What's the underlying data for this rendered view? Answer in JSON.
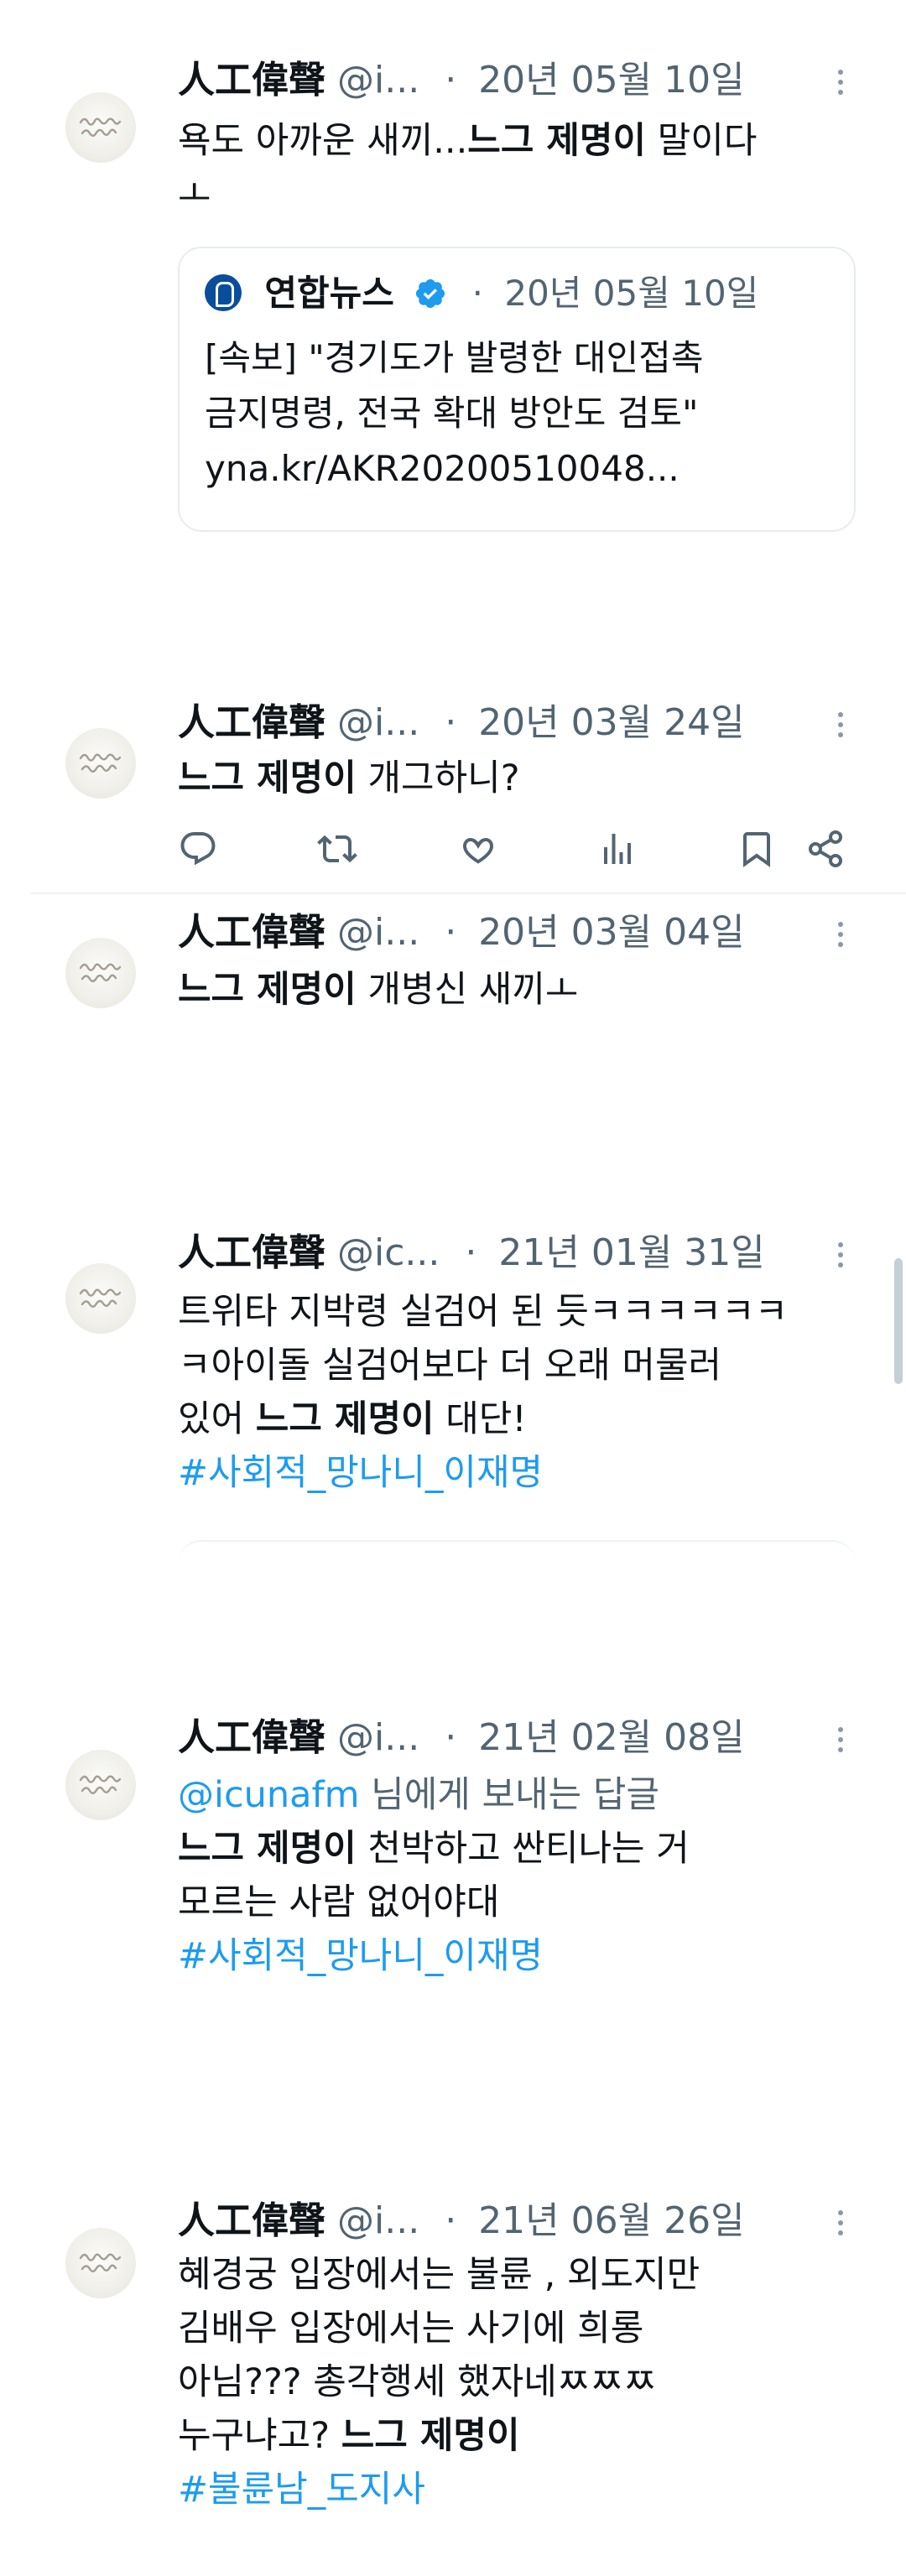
{
  "author": {
    "name": "人工偉聲"
  },
  "tweets": [
    {
      "handle": "@i...",
      "date": "20년 05월 10일",
      "text_before": "욕도 아까운 새끼...",
      "mention": "느그 제명이",
      "text_after": " 말이다\nㅗ",
      "quote": {
        "source": "연합뉴스",
        "date": "20년 05월 10일",
        "text": "[속보] \"경기도가 발령한 대인접촉\n금지명령, 전국 확대 방안도 검토\"\nyna.kr/AKR20200510048..."
      }
    },
    {
      "handle": "@i...",
      "date": "20년 03월 24일",
      "mention": "느그 제명이",
      "text_after": " 개그하니?"
    },
    {
      "handle": "@i...",
      "date": "20년 03월 04일",
      "mention": "느그 제명이",
      "text_after": " 개병신 새끼ㅗ"
    },
    {
      "handle": "@ic...",
      "date": "21년 01월 31일",
      "text_before": "트위타 지박령 실검어 된 듯ㅋㅋㅋㅋㅋㅋ\nㅋ아이돌 실검어보다 더 오래 머물러\n있어 ",
      "mention": "느그 제명이",
      "text_after": " 대단!",
      "hashtag": "#사회적_망나니_이재명"
    },
    {
      "handle": "@i...",
      "date": "21년 02월 08일",
      "reply_to": "@icunafm",
      "reply_suffix": " 님에게 보내는 답글",
      "mention": "느그 제명이",
      "text_after": " 천박하고 싼티나는 거\n모르는 사람 없어야대",
      "hashtag": "#사회적_망나니_이재명"
    },
    {
      "handle": "@i...",
      "date": "21년 06월 26일",
      "text_before": "혜경궁 입장에서는 불륜 , 외도지만\n김배우 입장에서는 사기에 희롱\n아님??? 총각행세 했자네ㅉㅉㅉ\n누구냐고? ",
      "mention": "느그 제명이",
      "hashtag": "#불륜남_도지사"
    }
  ],
  "icons": {
    "reply": "reply-icon",
    "retweet": "retweet-icon",
    "like": "heart-icon",
    "views": "views-icon",
    "bookmark": "bookmark-icon",
    "share": "share-icon",
    "more": "more-icon",
    "verified": "verified-badge-icon"
  },
  "colors": {
    "text": "#0f1419",
    "secondary": "#536471",
    "link": "#1d9bf0",
    "border": "#eff3f4"
  }
}
